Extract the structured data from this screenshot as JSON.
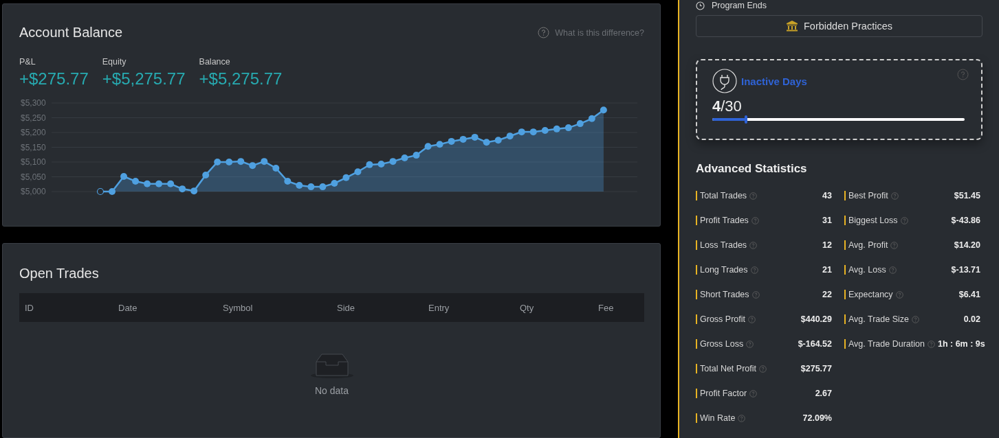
{
  "account_balance": {
    "title": "Account Balance",
    "help_link": "What is this difference?",
    "metrics": [
      {
        "label": "P&L",
        "value": "+$275.77"
      },
      {
        "label": "Equity",
        "value": "+$5,275.77"
      },
      {
        "label": "Balance",
        "value": "+$5,275.77"
      }
    ],
    "chart_data": {
      "type": "area",
      "yticks": [
        {
          "value": 5000,
          "label": "$5,000"
        },
        {
          "value": 5050,
          "label": "$5,050"
        },
        {
          "value": 5100,
          "label": "$5,100"
        },
        {
          "value": 5150,
          "label": "$5,150"
        },
        {
          "value": 5200,
          "label": "$5,200"
        },
        {
          "value": 5250,
          "label": "$5,250"
        },
        {
          "value": 5300,
          "label": "$5,300"
        }
      ],
      "ylim": [
        5000,
        5300
      ],
      "grid": true,
      "series": [
        {
          "color": "#4fa0e0",
          "values": [
            5000,
            5000,
            5051,
            5035,
            5026,
            5026,
            5026,
            5009,
            5002,
            5056,
            5100,
            5100,
            5102,
            5088,
            5102,
            5079,
            5035,
            5021,
            5016,
            5016,
            5028,
            5047,
            5067,
            5091,
            5093,
            5102,
            5114,
            5123,
            5153,
            5160,
            5170,
            5177,
            5184,
            5167,
            5174,
            5188,
            5202,
            5202,
            5207,
            5212,
            5216,
            5230,
            5247,
            5276
          ]
        }
      ]
    }
  },
  "open_trades": {
    "title": "Open Trades",
    "columns": [
      "ID",
      "Date",
      "Symbol",
      "Side",
      "Entry",
      "Qty",
      "Fee"
    ],
    "empty_text": "No data"
  },
  "sidebar": {
    "program_ends": "Program Ends",
    "forbidden_button": "Forbidden Practices",
    "inactive_days": {
      "title": "Inactive Days",
      "current": "4",
      "total": "/30",
      "level": 0.133
    },
    "advanced_title": "Advanced Statistics",
    "stats_left": [
      {
        "label": "Total Trades",
        "value": "43"
      },
      {
        "label": "Profit Trades",
        "value": "31"
      },
      {
        "label": "Loss Trades",
        "value": "12"
      },
      {
        "label": "Long Trades",
        "value": "21"
      },
      {
        "label": "Short Trades",
        "value": "22"
      },
      {
        "label": "Gross Profit",
        "value": "$440.29"
      },
      {
        "label": "Gross Loss",
        "value": "$-164.52"
      },
      {
        "label": "Total Net Profit",
        "value": "$275.77"
      },
      {
        "label": "Profit Factor",
        "value": "2.67"
      },
      {
        "label": "Win Rate",
        "value": "72.09%"
      }
    ],
    "stats_right": [
      {
        "label": "Best Profit",
        "value": "$51.45"
      },
      {
        "label": "Biggest Loss",
        "value": "$-43.86"
      },
      {
        "label": "Avg. Profit",
        "value": "$14.20"
      },
      {
        "label": "Avg. Loss",
        "value": "$-13.71"
      },
      {
        "label": "Expectancy",
        "value": "$6.41"
      },
      {
        "label": "Avg. Trade Size",
        "value": "0.02"
      },
      {
        "label": "Avg. Trade Duration",
        "value": "1h : 6m : 9s"
      }
    ]
  }
}
